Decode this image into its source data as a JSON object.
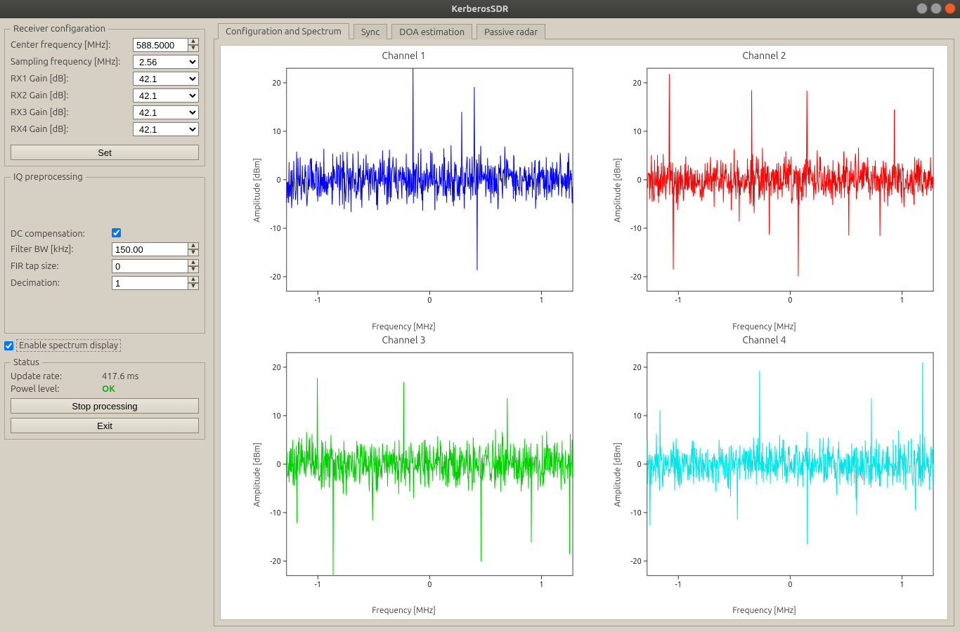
{
  "window": {
    "title": "KerberosSDR"
  },
  "tabs": [
    {
      "id": "config",
      "label": "Configuration and Spectrum",
      "active": true
    },
    {
      "id": "sync",
      "label": "Sync",
      "active": false
    },
    {
      "id": "doa",
      "label": "DOA estimation",
      "active": false
    },
    {
      "id": "passive",
      "label": "Passive radar",
      "active": false
    }
  ],
  "receiver": {
    "legend": "Receiver configaration",
    "center_freq_label": "Center frequency [MHz]:",
    "center_freq_value": "588.5000",
    "samp_freq_label": "Sampling frequency [MHz]:",
    "samp_freq_value": "2.56",
    "rx1_label": "RX1 Gain [dB]:",
    "rx1_value": "42.1",
    "rx2_label": "RX2 Gain [dB]:",
    "rx2_value": "42.1",
    "rx3_label": "RX3 Gain [dB]:",
    "rx3_value": "42.1",
    "rx4_label": "RX4 Gain [dB]:",
    "rx4_value": "42.1",
    "set_label": "Set"
  },
  "iq": {
    "legend": "IQ preprocessing",
    "dc_label": "DC compensation:",
    "dc_checked": true,
    "filterbw_label": "Filter BW [kHz]:",
    "filterbw_value": "150.00",
    "firtap_label": "FIR tap size:",
    "firtap_value": "0",
    "decim_label": "Decimation:",
    "decim_value": "1"
  },
  "enable_spectrum": {
    "label": "Enable spectrum display",
    "checked": true
  },
  "status": {
    "legend": "Status",
    "update_rate_label": "Update rate:",
    "update_rate_value": "417.6 ms",
    "power_label": "Powel level:",
    "power_value": "OK",
    "stop_label": "Stop processing",
    "exit_label": "Exit"
  },
  "chart_data": [
    {
      "type": "line",
      "title": "Channel 1",
      "xlabel": "Frequency [MHz]",
      "ylabel": "Amplitude [dBm]",
      "xlim": [
        -1.28,
        1.28
      ],
      "ylim": [
        -23,
        23
      ],
      "xticks": [
        -1,
        0,
        1
      ],
      "yticks": [
        -20,
        -10,
        0,
        10,
        20
      ],
      "color": "#0000ff",
      "series_desc": "dense noise spectrum, mean≈0 dBm, σ≈4, spikes to +20/-23",
      "seed": 1
    },
    {
      "type": "line",
      "title": "Channel 2",
      "xlabel": "Frequency [MHz]",
      "ylabel": "Amplitude [dBm]",
      "xlim": [
        -1.28,
        1.28
      ],
      "ylim": [
        -23,
        23
      ],
      "xticks": [
        -1,
        0,
        1
      ],
      "yticks": [
        -20,
        -10,
        0,
        10,
        20
      ],
      "color": "#ff0000",
      "series_desc": "dense noise spectrum, mean≈0 dBm, σ≈4, spikes to +20/-20",
      "seed": 2
    },
    {
      "type": "line",
      "title": "Channel 3",
      "xlabel": "Frequency [MHz]",
      "ylabel": "Amplitude [dBm]",
      "xlim": [
        -1.28,
        1.28
      ],
      "ylim": [
        -23,
        23
      ],
      "xticks": [
        -1,
        0,
        1
      ],
      "yticks": [
        -20,
        -10,
        0,
        10,
        20
      ],
      "color": "#00d000",
      "series_desc": "dense noise spectrum, mean≈0 dBm, σ≈4, spikes to +20/-18",
      "seed": 3
    },
    {
      "type": "line",
      "title": "Channel 4",
      "xlabel": "Frequency [MHz]",
      "ylabel": "Amplitude [dBm]",
      "xlim": [
        -1.28,
        1.28
      ],
      "ylim": [
        -23,
        23
      ],
      "xticks": [
        -1,
        0,
        1
      ],
      "yticks": [
        -20,
        -10,
        0,
        10,
        20
      ],
      "color": "#00e5e5",
      "series_desc": "dense noise spectrum, mean≈0 dBm, σ≈4, spikes to +18/-20",
      "seed": 4
    }
  ]
}
